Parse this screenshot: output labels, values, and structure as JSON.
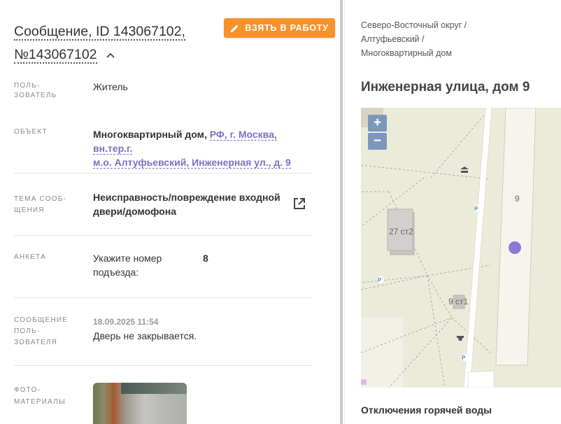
{
  "message": {
    "title_line1": "Сообщение, ID 143067102,",
    "title_line2": "№143067102",
    "take_button": "ВЗЯТЬ В РАБОТУ"
  },
  "fields": {
    "user_label_1": "ПОЛЬ-",
    "user_label_2": "ЗОВАТЕЛЬ",
    "user_value": "Житель",
    "object_label": "ОБЪЕКТ",
    "object_type": "Многоквартирный дом,",
    "object_addr_1": "РФ, г. Москва, вн.тер.г.",
    "object_addr_2": "м.о. Алтуфьевский, Инженерная ул., д. 9",
    "topic_label_1": "ТЕМА СООБ-",
    "topic_label_2": "ЩЕНИЯ",
    "topic_value_1": "Неисправность/повреждение входной",
    "topic_value_2": "двери/домофона",
    "form_label": "АНКЕТА",
    "form_q_1": "Укажите номер",
    "form_q_2": "подъезда:",
    "form_a": "8",
    "msg_label_1": "СООБЩЕНИЕ",
    "msg_label_2": "ПОЛЬ-",
    "msg_label_3": "ЗОВАТЕЛЯ",
    "msg_date": "18.09.2025 11:54",
    "msg_text": "Дверь не закрывается.",
    "photo_label_1": "ФОТО-",
    "photo_label_2": "МАТЕРИАЛЫ"
  },
  "right": {
    "crumb_1": "Северо-Восточный округ /",
    "crumb_2": "Алтуфьевский /",
    "crumb_3": "Многоквартирный дом",
    "address": "Инженерная улица, дом 9",
    "outage_title": "Отключения горячей воды"
  },
  "map": {
    "zoom_in": "+",
    "zoom_out": "−",
    "label_27": "27 ст2",
    "label_9": "9",
    "label_9st1": "9 ст1",
    "parking": "P"
  },
  "colors": {
    "accent": "#f7922a",
    "link": "#7e6fc0",
    "marker": "#8a7ad6",
    "map_bg": "#ecead9"
  }
}
